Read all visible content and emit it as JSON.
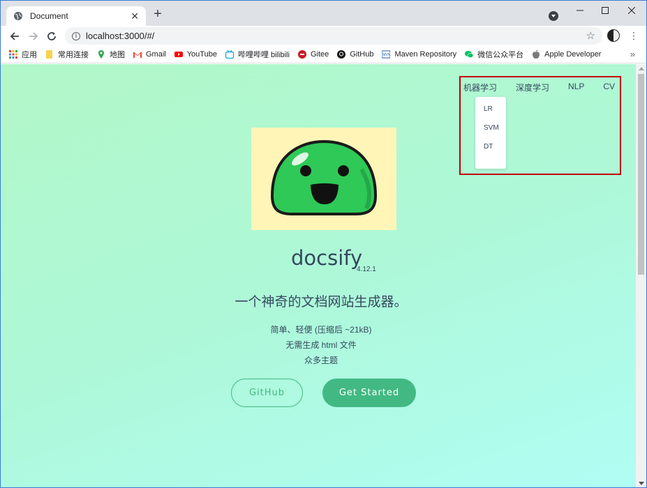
{
  "browser": {
    "tab_title": "Document",
    "tab_close": "✕",
    "new_tab": "+",
    "url": "localhost:3000/#/",
    "bookmarks": [
      {
        "label": "应用",
        "icon": "apps-grid-icon"
      },
      {
        "label": "常用连接",
        "icon": "folder-icon"
      },
      {
        "label": "地图",
        "icon": "maps-icon"
      },
      {
        "label": "Gmail",
        "icon": "gmail-icon"
      },
      {
        "label": "YouTube",
        "icon": "youtube-icon"
      },
      {
        "label": "哔哩哔哩 bilibili",
        "icon": "bilibili-icon"
      },
      {
        "label": "Gitee",
        "icon": "gitee-icon"
      },
      {
        "label": "GitHub",
        "icon": "github-icon"
      },
      {
        "label": "Maven Repository",
        "icon": "maven-icon"
      },
      {
        "label": "微信公众平台",
        "icon": "wechat-icon"
      },
      {
        "label": "Apple Developer",
        "icon": "apple-icon"
      }
    ],
    "more": "»"
  },
  "nav": {
    "items": [
      "机器学习",
      "深度学习",
      "NLP",
      "CV"
    ],
    "dropdown": [
      "LR",
      "SVM",
      "DT"
    ]
  },
  "cover": {
    "name": "docsify",
    "version": "4.12.1",
    "tagline": "一个神奇的文档网站生成器。",
    "features": [
      "简单、轻便 (压缩后 ~21kB)",
      "无需生成 html 文件",
      "众多主题"
    ],
    "github_button": "GitHub",
    "start_button": "Get Started"
  },
  "colors": {
    "accent": "#42b983",
    "text": "#34495e",
    "highlight": "#c00000",
    "logo_bg": "#fef5b7"
  }
}
